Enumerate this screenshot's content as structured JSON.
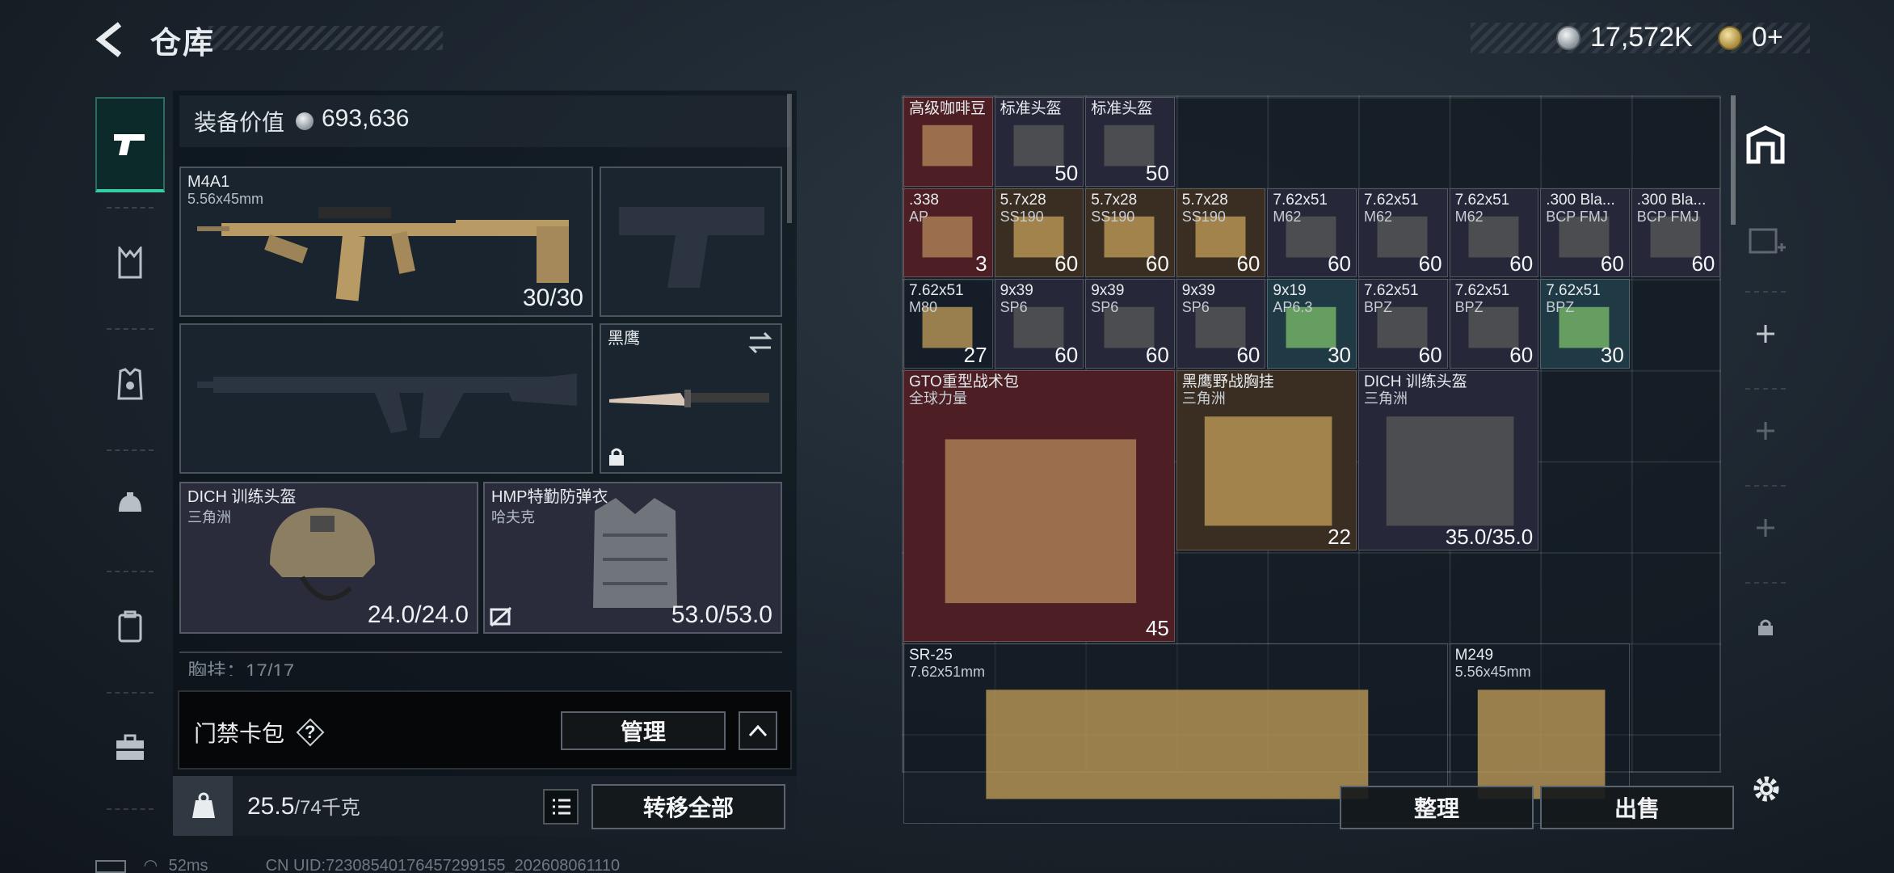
{
  "header": {
    "title": "仓库",
    "silver_amount": "17,572K",
    "gold_amount": "0+"
  },
  "left_panel": {
    "value_label": "装备价值",
    "value_amount": "693,636",
    "slots": {
      "primary": {
        "name": "M4A1",
        "caliber": "5.56x45mm",
        "ammo": "30/30"
      },
      "melee": {
        "name": "黑鹰"
      },
      "helmet": {
        "name": "DICH 训练头盔",
        "map": "三角洲",
        "durability": "24.0/24.0"
      },
      "armor": {
        "name": "HMP特勤防弹衣",
        "map": "哈夫克",
        "durability": "53.0/53.0"
      }
    },
    "chest_rig_row": "胸挂：17/17",
    "key_bag_label": "门禁卡包",
    "key_help": "?",
    "manage_label": "管理",
    "weight_value": "25.5",
    "weight_total": "/74千克",
    "transfer_all_label": "转移全部"
  },
  "stash": {
    "items": [
      {
        "name": "高级咖啡豆",
        "sub": "",
        "count": "",
        "bg": "red"
      },
      {
        "name": "标准头盔",
        "sub": "",
        "count": "50",
        "bg": "blue"
      },
      {
        "name": "标准头盔",
        "sub": "",
        "count": "50",
        "bg": "blue"
      },
      {
        "name": ".338",
        "sub": "AP",
        "count": "3",
        "bg": "red"
      },
      {
        "name": "5.7x28",
        "sub": "SS190",
        "count": "60",
        "bg": "brown"
      },
      {
        "name": "5.7x28",
        "sub": "SS190",
        "count": "60",
        "bg": "brown"
      },
      {
        "name": "5.7x28",
        "sub": "SS190",
        "count": "60",
        "bg": "brown"
      },
      {
        "name": "7.62x51",
        "sub": "M62",
        "count": "60",
        "bg": "blue"
      },
      {
        "name": "7.62x51",
        "sub": "M62",
        "count": "60",
        "bg": "blue"
      },
      {
        "name": "7.62x51",
        "sub": "M62",
        "count": "60",
        "bg": "blue"
      },
      {
        "name": ".300 Bla...",
        "sub": "BCP FMJ",
        "count": "60",
        "bg": "blue"
      },
      {
        "name": ".300 Bla...",
        "sub": "BCP FMJ",
        "count": "60",
        "bg": "blue"
      },
      {
        "name": "7.62x51",
        "sub": "M80",
        "count": "27",
        "bg": "none"
      },
      {
        "name": "9x39",
        "sub": "SP6",
        "count": "60",
        "bg": "blue"
      },
      {
        "name": "9x39",
        "sub": "SP6",
        "count": "60",
        "bg": "blue"
      },
      {
        "name": "9x39",
        "sub": "SP6",
        "count": "60",
        "bg": "blue"
      },
      {
        "name": "9x19",
        "sub": "AP6.3",
        "count": "30",
        "bg": "teal"
      },
      {
        "name": "7.62x51",
        "sub": "BPZ",
        "count": "60",
        "bg": "blue"
      },
      {
        "name": "7.62x51",
        "sub": "BPZ",
        "count": "60",
        "bg": "blue"
      },
      {
        "name": "7.62x51",
        "sub": "BPZ",
        "count": "30",
        "bg": "teal"
      },
      {
        "name": "GTO重型战术包",
        "sub": "全球力量",
        "count": "45",
        "bg": "red"
      },
      {
        "name": "黑鹰野战胸挂",
        "sub": "三角洲",
        "count": "22",
        "bg": "brown"
      },
      {
        "name": "DICH 训练头盔",
        "sub": "三角洲",
        "count": "35.0/35.0",
        "bg": "blue"
      },
      {
        "name": "SR-25",
        "sub": "7.62x51mm",
        "count": "",
        "bg": "none"
      },
      {
        "name": "M249",
        "sub": "5.56x45mm",
        "count": "",
        "bg": "none"
      }
    ],
    "sort_label": "整理",
    "sell_label": "出售"
  },
  "status": {
    "ping": "52ms",
    "uid": "CN UID:72308540176457299155_202608061110"
  },
  "colors": {
    "accent": "#35d0a2",
    "red_bg": "#4d1f24",
    "blue_bg": "#26283a"
  }
}
